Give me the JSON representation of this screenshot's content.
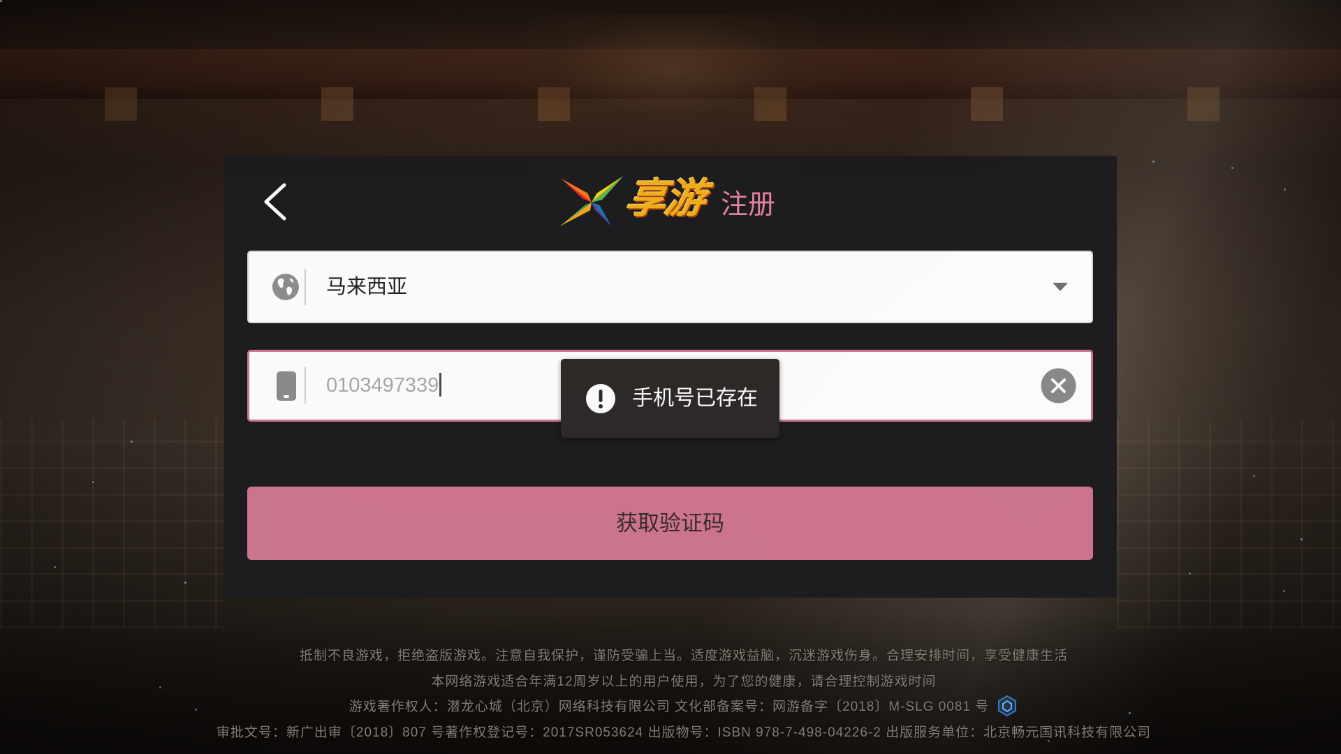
{
  "header": {
    "back_icon": "chevron-left-icon",
    "logo_icon": "xiangyou-star-logo-icon",
    "logo_text": "享游",
    "title": "注册"
  },
  "country_field": {
    "icon": "globe-icon",
    "value": "马来西亚",
    "dropdown_icon": "caret-down-icon"
  },
  "phone_field": {
    "icon": "phone-icon",
    "value": "0103497339",
    "clear_icon": "clear-circle-icon"
  },
  "submit_button": {
    "label": "获取验证码"
  },
  "toast": {
    "icon": "exclamation-circle-icon",
    "message": "手机号已存在"
  },
  "footer": {
    "lines": [
      "抵制不良游戏，拒绝盗版游戏。注意自我保护，谨防受骗上当。适度游戏益脑，沉迷游戏伤身。合理安排时间，享受健康生活",
      "本网络游戏适合年满12周岁以上的用户使用，为了您的健康，请合理控制游戏时间",
      "游戏著作权人：潜龙心城（北京）网络科技有限公司 文化部备案号：网游备字〔2018〕M-SLG 0081 号",
      "审批文号：新广出审〔2018〕807 号著作权登记号：2017SR053624 出版物号：ISBN 978-7-498-04226-2 出版服务单位：北京畅元国讯科技有限公司"
    ],
    "badge_icon": "government-badge-icon"
  },
  "colors": {
    "accent": "#cf7690",
    "title": "#e482a5",
    "dialog_bg": "#1d1c1f",
    "toast_bg": "#2c2928",
    "logo_yellow": "#f2b01e"
  }
}
